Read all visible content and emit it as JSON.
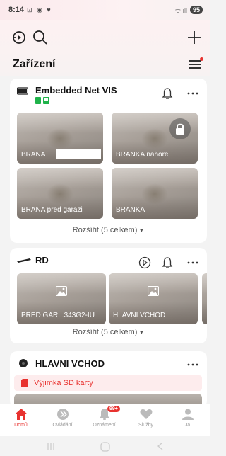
{
  "status_bar": {
    "time": "8:14",
    "icons": [
      "signal-icon",
      "shield-icon",
      "heart-icon"
    ],
    "battery": "95"
  },
  "toolbar": {
    "left_icons": [
      "history-icon",
      "search-icon"
    ],
    "right_icon": "plus-icon"
  },
  "page": {
    "title": "Zařízení"
  },
  "devices": [
    {
      "name": "Embedded Net VIS",
      "cameras": [
        {
          "label": "BRANA"
        },
        {
          "label": "BRANKA nahore"
        },
        {
          "label": "BRANA pred garazi"
        },
        {
          "label": "BRANKA"
        }
      ],
      "expand_label": "Rozšířit (5 celkem)"
    },
    {
      "name": "RD",
      "cameras": [
        {
          "label": "PRED GAR...343G2-IU"
        },
        {
          "label": "HLAVNI VCHOD"
        }
      ],
      "expand_label": "Rozšířit (5 celkem)"
    },
    {
      "name": "HLAVNI VCHOD",
      "alert": "Výjimka SD karty"
    }
  ],
  "bottom_nav": [
    {
      "label": "Domů",
      "icon": "home-icon",
      "active": true
    },
    {
      "label": "Ovládání",
      "icon": "control-icon"
    },
    {
      "label": "Oznámení",
      "icon": "bell-icon",
      "badge": "99+"
    },
    {
      "label": "Služby",
      "icon": "heart-icon"
    },
    {
      "label": "Já",
      "icon": "user-icon"
    }
  ],
  "colors": {
    "accent": "#e8322f",
    "device_green": "#1fb34a"
  }
}
